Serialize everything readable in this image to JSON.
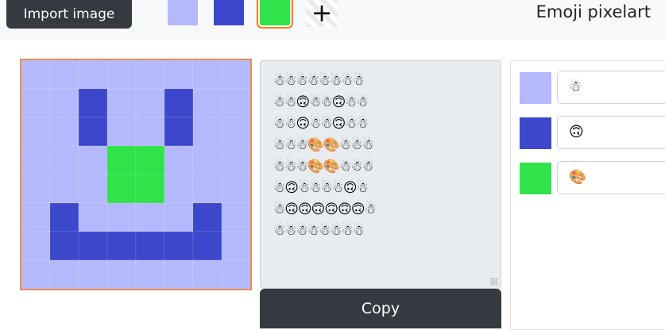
{
  "toolbar": {
    "import_label": "Import image",
    "add_label": "+",
    "brand": "Emoji pixelart",
    "colors": [
      "#b3b9fc",
      "#3d47cc",
      "#30e34b"
    ],
    "selected_color_index": 2
  },
  "canvas": {
    "grid_cols": 8,
    "grid_rows": 8,
    "palette": [
      "#b3b9fc",
      "#3d47cc",
      "#30e34b"
    ],
    "pixels": [
      [
        0,
        0,
        0,
        0,
        0,
        0,
        0,
        0
      ],
      [
        0,
        0,
        1,
        0,
        0,
        1,
        0,
        0
      ],
      [
        0,
        0,
        1,
        0,
        0,
        1,
        0,
        0
      ],
      [
        0,
        0,
        0,
        2,
        2,
        0,
        0,
        0
      ],
      [
        0,
        0,
        0,
        2,
        2,
        0,
        0,
        0
      ],
      [
        0,
        1,
        0,
        0,
        0,
        0,
        1,
        0
      ],
      [
        0,
        1,
        1,
        1,
        1,
        1,
        1,
        0
      ],
      [
        0,
        0,
        0,
        0,
        0,
        0,
        0,
        0
      ]
    ]
  },
  "output": {
    "rows": [
      "☃☃☃☃☃☃☃☃",
      "☃☃🙃☃☃🙃☃☃",
      "☃☃🙃☃☃🙃☃☃",
      "☃☃☃🎨🎨☃☃☃",
      "☃☃☃🎨🎨☃☃☃",
      "☃🙃☃☃☃☃🙃☃",
      "☃🙃🙃🙃🙃🙃🙃☃",
      "☃☃☃☃☃☃☃☃"
    ],
    "copy_label": "Copy"
  },
  "mappings": [
    {
      "color": "#b3b9fc",
      "emoji": "☃"
    },
    {
      "color": "#3d47cc",
      "emoji": "🙃"
    },
    {
      "color": "#30e34b",
      "emoji": "🎨"
    }
  ]
}
